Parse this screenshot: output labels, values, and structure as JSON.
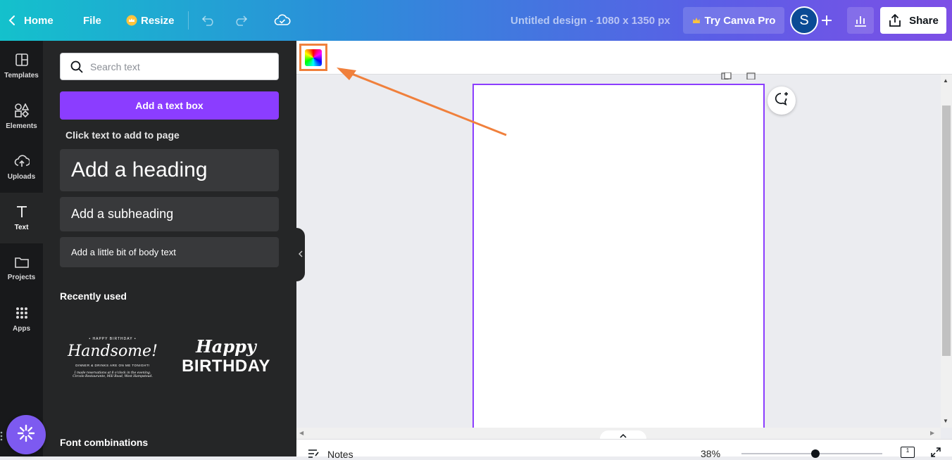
{
  "topbar": {
    "home_label": "Home",
    "file_label": "File",
    "resize_label": "Resize",
    "design_title": "Untitled design - 1080 x 1350 px",
    "try_pro_label": "Try Canva Pro",
    "avatar_initial": "S",
    "share_label": "Share"
  },
  "leftnav": [
    {
      "label": "Templates",
      "icon": "templates-icon"
    },
    {
      "label": "Elements",
      "icon": "elements-icon"
    },
    {
      "label": "Uploads",
      "icon": "uploads-icon"
    },
    {
      "label": "Text",
      "icon": "text-icon"
    },
    {
      "label": "Projects",
      "icon": "projects-icon"
    },
    {
      "label": "Apps",
      "icon": "apps-icon"
    }
  ],
  "panel": {
    "search_placeholder": "Search text",
    "add_text_box_label": "Add a text box",
    "hint": "Click text to add to page",
    "heading_label": "Add a heading",
    "subheading_label": "Add a subheading",
    "body_label": "Add a little bit of body text",
    "recently_used_title": "Recently used",
    "recent1": {
      "small_top": "• HAPPY BIRTHDAY •",
      "script": "Handsome!",
      "line1": "DINNER & DRINKS ARE ON ME TONIGHT!",
      "line2": "I made reservations at 8 o'clock in the evening.",
      "line3": "Circolo Restaurante, Mill Road, West Hampstead."
    },
    "recent2": {
      "script": "Happy",
      "block": "BIRTHDAY"
    },
    "font_combinations_title": "Font combinations"
  },
  "bottombar": {
    "notes_label": "Notes",
    "zoom": "38%",
    "zoom_fraction": 0.38,
    "page_count": "1"
  },
  "colors": {
    "accent": "#8b3dff",
    "highlight": "#f0803c"
  }
}
